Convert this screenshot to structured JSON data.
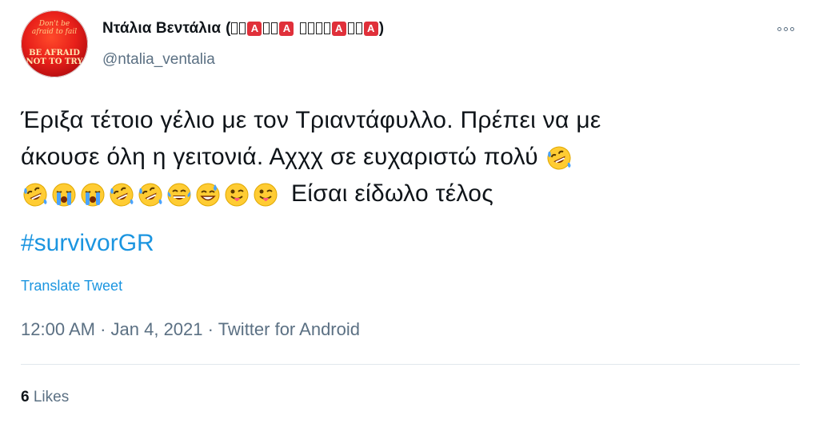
{
  "user": {
    "display_name": "Ντάλια Βεντάλια",
    "handle": "@ntalia_ventalia",
    "name_badge_letter": "A",
    "avatar_text_top": "Don't be afraid to fail",
    "avatar_text_bottom": "BE AFRAID NOT TO TRY"
  },
  "tweet": {
    "line1": "Έριξα τέτοιο γέλιο με τον Τριαντάφυλλο. Πρέπει να με",
    "line2": "άκουσε όλη η γειτονιά. Αχχχ σε ευχαριστώ πολύ",
    "line3_text": "Είσαι είδωλο τέλος",
    "line2_emojis": [
      "rofl-emoji"
    ],
    "line3_emojis": [
      "rofl-emoji",
      "loudly-crying-emoji",
      "loudly-crying-emoji",
      "rofl-emoji",
      "rofl-emoji",
      "joy-emoji",
      "sweat-smile-emoji",
      "winking-tongue-emoji",
      "winking-tongue-emoji"
    ],
    "hashtag": "#survivorGR"
  },
  "translate_label": "Translate Tweet",
  "meta": {
    "time": "12:00 AM",
    "separator": "·",
    "date": "Jan 4, 2021",
    "source": "Twitter for Android"
  },
  "likes": {
    "count": "6",
    "label": "Likes"
  },
  "colors": {
    "link": "#1b95e0",
    "secondary": "#5b7083",
    "badge": "#e0303a"
  },
  "icons": {
    "more": "more-icon"
  }
}
